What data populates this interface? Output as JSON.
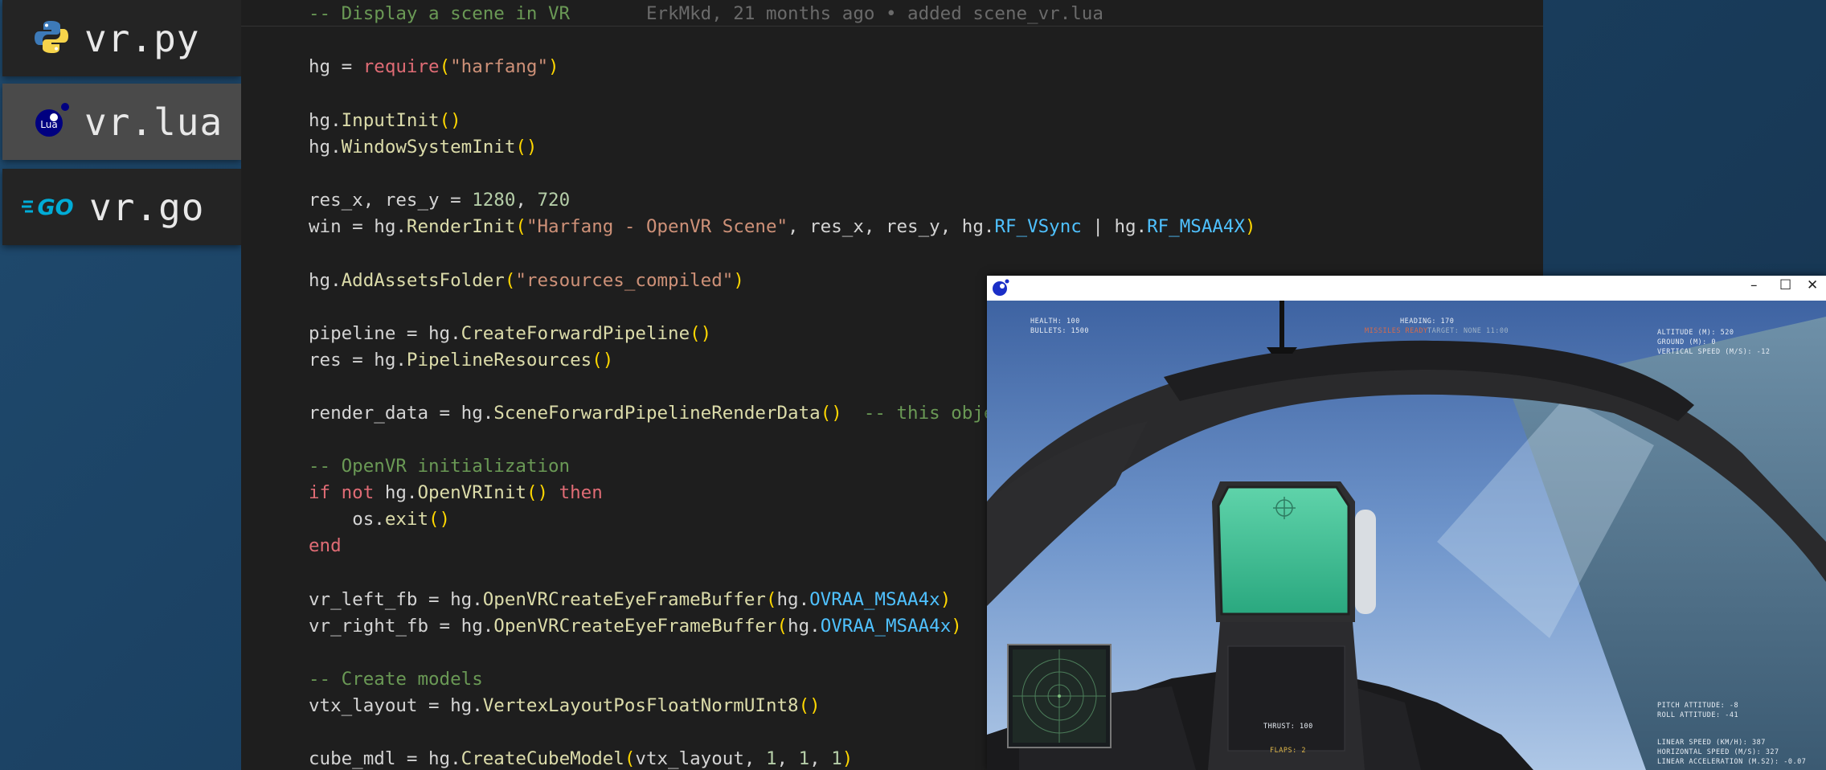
{
  "tabs": [
    {
      "label": "vr.py",
      "icon": "python-icon"
    },
    {
      "label": "vr.lua",
      "icon": "lua-icon",
      "icon_text": "Lua"
    },
    {
      "label": "vr.go",
      "icon": "go-icon",
      "icon_text": "GO"
    }
  ],
  "editor": {
    "first_line": "-- Display a scene in VR",
    "blame": "ErkMkd, 21 months ago • added scene_vr.lua",
    "lines": [
      {
        "t": "hg",
        "op": " = ",
        "fn": "require",
        "a": "(",
        "s": "\"harfang\"",
        "b": ")"
      },
      {
        "obj": "hg",
        "dot": ".",
        "fn": "InputInit",
        "paren": "()"
      },
      {
        "obj": "hg",
        "dot": ".",
        "fn": "WindowSystemInit",
        "paren": "()"
      },
      {
        "a": "res_x",
        "comma": ", ",
        "b": "res_y",
        "op": " = ",
        "n1": "1280",
        "comma2": ", ",
        "n2": "720"
      },
      {
        "a": "win",
        "op": " = ",
        "obj": "hg",
        "dot": ".",
        "fn": "RenderInit",
        "p1": "(",
        "s": "\"Harfang - OpenVR Scene\"",
        "rest1": ", res_x, res_y, ",
        "obj2": "hg",
        "dot2": ".",
        "c1": "RF_VSync",
        "bar": " | ",
        "obj3": "hg",
        "dot3": ".",
        "c2": "RF_MSAA4X",
        "p2": ")"
      },
      {
        "obj": "hg",
        "dot": ".",
        "fn": "AddAssetsFolder",
        "p1": "(",
        "s": "\"resources_compiled\"",
        "p2": ")"
      },
      {
        "a": "pipeline",
        "op": " = ",
        "obj": "hg",
        "dot": ".",
        "fn": "CreateForwardPipeline",
        "paren": "()"
      },
      {
        "a": "res",
        "op": " = ",
        "obj": "hg",
        "dot": ".",
        "fn": "PipelineResources",
        "paren": "()"
      },
      {
        "a": "render_data",
        "op": " = ",
        "obj": "hg",
        "dot": ".",
        "fn": "SceneForwardPipelineRenderData",
        "paren": "()",
        "cm": "  -- this obje"
      },
      {
        "cm": "-- OpenVR initialization"
      },
      {
        "k1": "if",
        "k2": " not ",
        "obj": "hg",
        "dot": ".",
        "fn": "OpenVRInit",
        "paren": "()",
        "k3": " then"
      },
      {
        "ind": "    ",
        "obj": "os",
        "dot": ".",
        "fn": "exit",
        "paren": "()"
      },
      {
        "k1": "end"
      },
      {
        "a": "vr_left_fb",
        "op": " = ",
        "obj": "hg",
        "dot": ".",
        "fn": "OpenVRCreateEyeFrameBuffer",
        "p1": "(",
        "obj2": "hg",
        "dot2": ".",
        "c1": "OVRAA_MSAA4x",
        "p2": ")"
      },
      {
        "a": "vr_right_fb",
        "op": " = ",
        "obj": "hg",
        "dot": ".",
        "fn": "OpenVRCreateEyeFrameBuffer",
        "p1": "(",
        "obj2": "hg",
        "dot2": ".",
        "c1": "OVRAA_MSAA4x",
        "p2": ")"
      },
      {
        "cm": "-- Create models"
      },
      {
        "a": "vtx_layout",
        "op": " = ",
        "obj": "hg",
        "dot": ".",
        "fn": "VertexLayoutPosFloatNormUInt8",
        "paren": "()"
      },
      {
        "a": "cube_mdl",
        "op": " = ",
        "obj": "hg",
        "dot": ".",
        "fn": "CreateCubeModel",
        "p1": "(",
        "rest1": "vtx_layout, ",
        "n1": "1",
        "comma": ", ",
        "n2": "1",
        "comma2": ", ",
        "n3": "1",
        "p2": ")"
      }
    ]
  },
  "game_window": {
    "controls": {
      "minimize": "–",
      "maximize": "☐",
      "close": "✕"
    },
    "hud": {
      "health": "HEALTH: 100",
      "bullets": "BULLETS: 1500",
      "heading": "HEADING: 170",
      "heading_warn": "MISSILES READY",
      "heading_sub": "TARGET: NONE 11:00",
      "altitude": "ALTITUDE (M): 520",
      "ground": "GROUND (M): 0",
      "vspeed": "VERTICAL SPEED (M/S): -12",
      "pitch": "PITCH ATTITUDE: -8",
      "roll": "ROLL ATTITUDE: -41",
      "thrust": "THRUST: 100",
      "flaps": "FLAPS: 2",
      "linear_speed": "LINEAR SPEED (KM/H): 387",
      "horizontal_speed": "HORIZONTAL SPEED (M/S): 327",
      "linear_accel": "LINEAR ACCELERATION (M.S2): -0.07"
    }
  }
}
